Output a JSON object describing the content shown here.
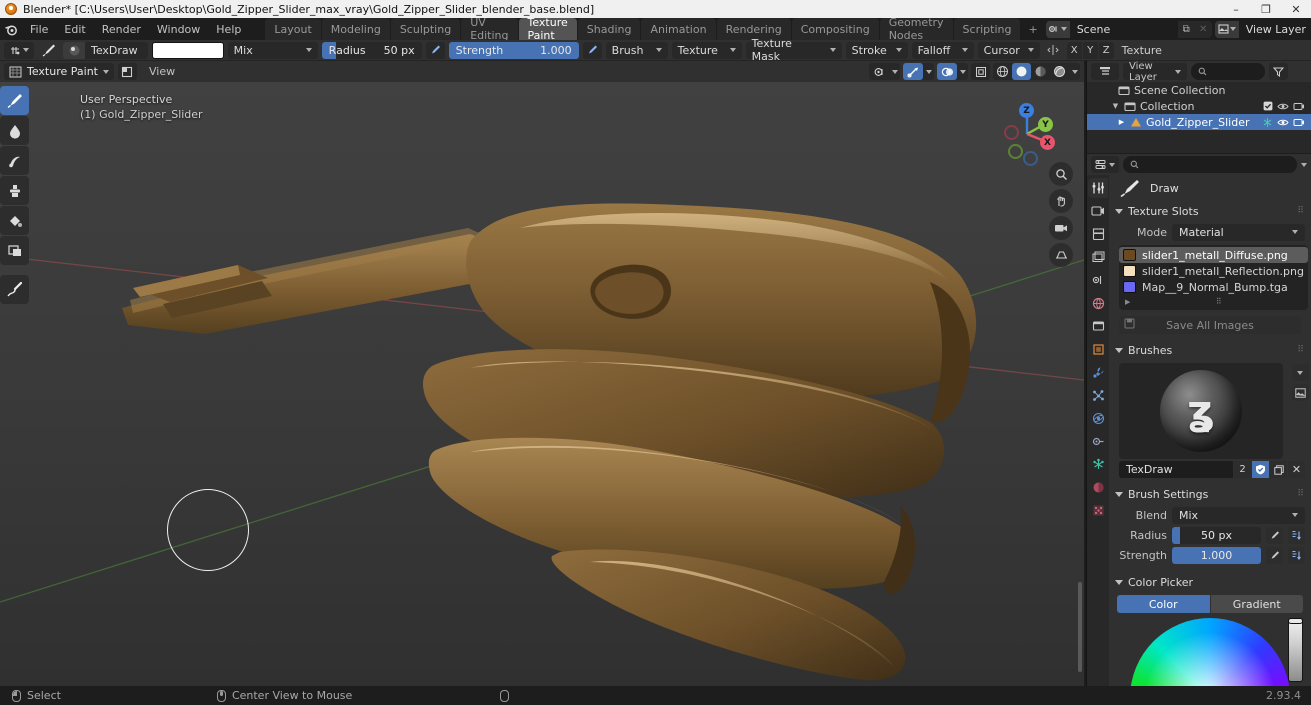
{
  "window": {
    "title": "Blender* [C:\\Users\\User\\Desktop\\Gold_Zipper_Slider_max_vray\\Gold_Zipper_Slider_blender_base.blend]",
    "minimize": "–",
    "maximize": "❐",
    "close": "✕"
  },
  "menus": [
    "File",
    "Edit",
    "Render",
    "Window",
    "Help"
  ],
  "workspace_tabs": [
    {
      "label": "Layout",
      "active": false
    },
    {
      "label": "Modeling",
      "active": false
    },
    {
      "label": "Sculpting",
      "active": false
    },
    {
      "label": "UV Editing",
      "active": false
    },
    {
      "label": "Texture Paint",
      "active": true
    },
    {
      "label": "Shading",
      "active": false
    },
    {
      "label": "Animation",
      "active": false
    },
    {
      "label": "Rendering",
      "active": false
    },
    {
      "label": "Compositing",
      "active": false
    },
    {
      "label": "Geometry Nodes",
      "active": false
    },
    {
      "label": "Scripting",
      "active": false
    },
    {
      "label": "+",
      "active": false
    }
  ],
  "topbar_right": {
    "scene_name": "Scene",
    "view_layer_name": "View Layer",
    "new_label": "⧉",
    "unlink_label": "✕"
  },
  "tool_settings": {
    "brush_name": "TexDraw",
    "color_value": "#ffffff",
    "blend_mode": "Mix",
    "radius_label": "Radius",
    "radius_value": "50 px",
    "strength_label": "Strength",
    "strength_value": "1.000",
    "popovers": [
      "Brush",
      "Texture",
      "Texture Mask",
      "Stroke",
      "Falloff",
      "Cursor"
    ],
    "symmetry_axes": [
      "X",
      "Y",
      "Z"
    ],
    "texture_label": "Texture"
  },
  "viewport_header": {
    "mode": "Texture Paint",
    "view_menu": "View"
  },
  "viewport": {
    "perspective_label": "User Perspective",
    "object_label": "(1) Gold_Zipper_Slider",
    "gizmo_axes": [
      {
        "label": "Z",
        "color": "#3b7fe0"
      },
      {
        "label": "Y",
        "color": "#88c446"
      },
      {
        "label": "X",
        "color": "#e8546b"
      }
    ],
    "model_color": "#7a5a33"
  },
  "tools": [
    {
      "name": "draw",
      "label": "Draw",
      "active": true
    },
    {
      "name": "soften",
      "label": "Soften",
      "active": false
    },
    {
      "name": "smear",
      "label": "Smear",
      "active": false
    },
    {
      "name": "clone",
      "label": "Clone",
      "active": false
    },
    {
      "name": "fill",
      "label": "Fill",
      "active": false
    },
    {
      "name": "mask",
      "label": "Mask",
      "active": false
    },
    {
      "name": "annotate",
      "label": "Annotate",
      "active": false
    }
  ],
  "outliner": {
    "rows": [
      {
        "label": "Scene Collection",
        "indent": 0,
        "selected": false,
        "disclosure": "",
        "icon": "collection-icon"
      },
      {
        "label": "Collection",
        "indent": 1,
        "selected": false,
        "disclosure": "▼",
        "icon": "collection-icon"
      },
      {
        "label": "Gold_Zipper_Slider",
        "indent": 2,
        "selected": true,
        "disclosure": "▶",
        "icon": "mesh-icon"
      }
    ]
  },
  "properties": {
    "tool_title": "Draw",
    "panels": {
      "texture_slots": {
        "title": "Texture Slots",
        "mode_label": "Mode",
        "mode_value": "Material",
        "slots": [
          {
            "name": "slider1_metall_Diffuse.png",
            "color": "#6b4a22",
            "selected": true
          },
          {
            "name": "slider1_metall_Reflection.png",
            "color": "#f6dfbe",
            "selected": false
          },
          {
            "name": "Map__9_Normal_Bump.tga",
            "color": "#6a68f2",
            "selected": false
          }
        ],
        "save_all_label": "Save All Images",
        "add_label": "+"
      },
      "brushes": {
        "title": "Brushes",
        "brush_name": "TexDraw",
        "users_count": "2",
        "fake_user_icon": "shield-icon",
        "duplicate_icon": "copy-icon",
        "delete_icon": "✕"
      },
      "brush_settings": {
        "title": "Brush Settings",
        "blend_label": "Blend",
        "blend_value": "Mix",
        "radius_label": "Radius",
        "radius_value": "50 px",
        "strength_label": "Strength",
        "strength_value": "1.000"
      },
      "color_picker": {
        "title": "Color Picker",
        "tabs": [
          {
            "label": "Color",
            "active": true
          },
          {
            "label": "Gradient",
            "active": false
          }
        ]
      }
    },
    "tabs": [
      {
        "name": "tool",
        "active": true
      },
      {
        "name": "render",
        "active": false
      },
      {
        "name": "output",
        "active": false
      },
      {
        "name": "view-layer",
        "active": false
      },
      {
        "name": "scene",
        "active": false
      },
      {
        "name": "world",
        "active": false
      },
      {
        "name": "collection",
        "active": false
      },
      {
        "name": "object",
        "active": false
      },
      {
        "name": "modifiers",
        "active": false
      },
      {
        "name": "particles",
        "active": false
      },
      {
        "name": "physics",
        "active": false
      },
      {
        "name": "constraints",
        "active": false
      },
      {
        "name": "data",
        "active": false
      },
      {
        "name": "material",
        "active": false
      },
      {
        "name": "texture",
        "active": false
      }
    ]
  },
  "statusbar": {
    "left_action": "Select",
    "middle_action": "Center View to Mouse",
    "version": "2.93.4"
  }
}
